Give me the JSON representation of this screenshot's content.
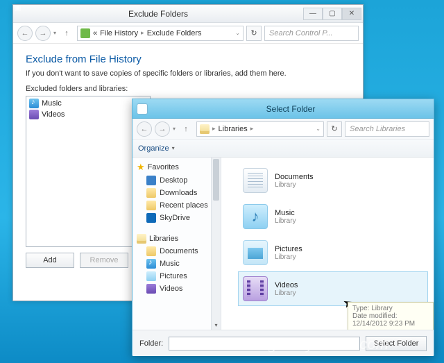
{
  "watermark": "groovyPost.com",
  "win1": {
    "title": "Exclude Folders",
    "breadcrumb": {
      "root": "File History",
      "current": "Exclude Folders"
    },
    "search_placeholder": "Search Control P...",
    "heading": "Exclude from File History",
    "description": "If you don't want to save copies of specific folders or libraries, add them here.",
    "list_label": "Excluded folders and libraries:",
    "excluded": [
      {
        "icon": "music",
        "label": "Music"
      },
      {
        "icon": "video",
        "label": "Videos"
      }
    ],
    "buttons": {
      "add": "Add",
      "remove": "Remove"
    },
    "wbtns": {
      "min": "—",
      "max": "▢",
      "close": "✕"
    }
  },
  "win2": {
    "title": "Select Folder",
    "breadcrumb": {
      "root": "Libraries"
    },
    "search_placeholder": "Search Libraries",
    "organize": "Organize",
    "sidebar": {
      "favorites": {
        "label": "Favorites",
        "items": [
          "Desktop",
          "Downloads",
          "Recent places",
          "SkyDrive"
        ]
      },
      "libraries": {
        "label": "Libraries",
        "items": [
          "Documents",
          "Music",
          "Pictures",
          "Videos"
        ]
      }
    },
    "libraries": [
      {
        "name": "Documents",
        "sub": "Library",
        "icon": "doc"
      },
      {
        "name": "Music",
        "sub": "Library",
        "icon": "mus"
      },
      {
        "name": "Pictures",
        "sub": "Library",
        "icon": "pic"
      },
      {
        "name": "Videos",
        "sub": "Library",
        "icon": "vid",
        "selected": true
      }
    ],
    "tooltip": {
      "line1": "Type: Library",
      "line2": "Date modified: 12/14/2012 9:23 PM"
    },
    "footer": {
      "label": "Folder:",
      "button": "Select Folder"
    }
  }
}
